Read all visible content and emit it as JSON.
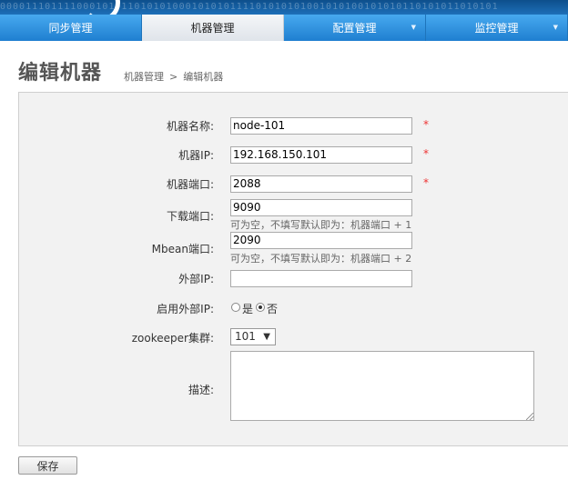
{
  "banner": {
    "bits": "000011101111000101011010101000101010111101010101001010100101010110101011010101"
  },
  "nav": {
    "tabs": [
      {
        "label": "同步管理"
      },
      {
        "label": "机器管理"
      },
      {
        "label": "配置管理",
        "caret": "▼"
      },
      {
        "label": "监控管理",
        "caret": "▼"
      }
    ]
  },
  "header": {
    "title": "编辑机器",
    "breadcrumb": [
      "机器管理",
      ">",
      "编辑机器"
    ]
  },
  "form": {
    "name": {
      "label": "机器名称:",
      "value": "node-101",
      "required": "*"
    },
    "ip": {
      "label": "机器IP:",
      "value": "192.168.150.101",
      "required": "*"
    },
    "port": {
      "label": "机器端口:",
      "value": "2088",
      "required": "*"
    },
    "download": {
      "label": "下载端口:",
      "value": "9090",
      "hint": "可为空，不填写默认即为：机器端口 + 1"
    },
    "mbean": {
      "label": "Mbean端口:",
      "value": "2090",
      "hint": "可为空，不填写默认即为：机器端口 + 2"
    },
    "external_ip": {
      "label": "外部IP:",
      "value": ""
    },
    "use_external": {
      "label": "启用外部IP:",
      "yes": "是",
      "no": "否",
      "selected": "否"
    },
    "zookeeper": {
      "label": "zookeeper集群:",
      "value": "101",
      "arrow": "▼"
    },
    "description": {
      "label": "描述:",
      "value": ""
    }
  },
  "actions": {
    "save_label": "保存"
  }
}
